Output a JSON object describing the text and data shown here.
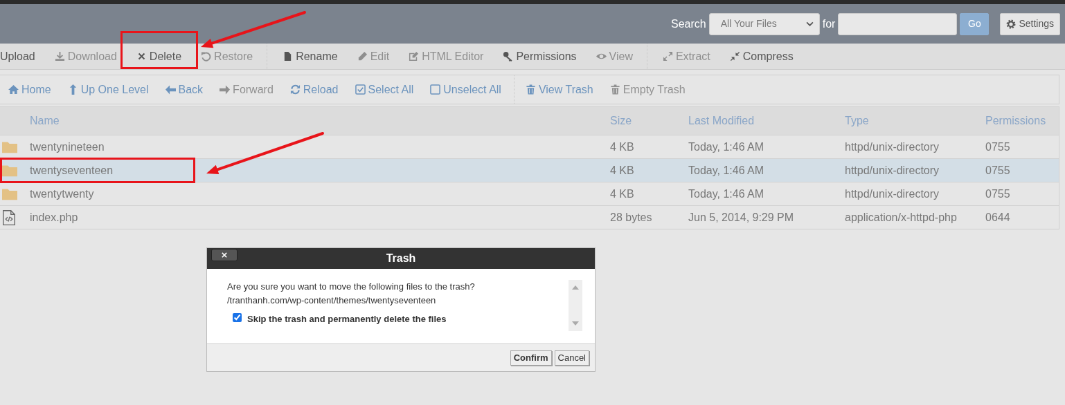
{
  "header": {
    "search_label": "Search",
    "scope": {
      "value": "All Your Files"
    },
    "for_label": "for",
    "go_button": "Go",
    "settings_button": "Settings"
  },
  "file_toolbar": {
    "groups": [
      {
        "tools": [
          {
            "label": "Upload",
            "disabled": false,
            "highlighted": false
          },
          {
            "label": "Download",
            "disabled": true,
            "highlighted": false
          },
          {
            "label": "Delete",
            "disabled": false,
            "highlighted": true
          },
          {
            "label": "Restore",
            "disabled": true,
            "highlighted": false
          }
        ]
      },
      {
        "tools": [
          {
            "label": "Rename",
            "disabled": false,
            "highlighted": false
          },
          {
            "label": "Edit",
            "disabled": true,
            "highlighted": false
          },
          {
            "label": "HTML Editor",
            "disabled": true,
            "highlighted": false
          },
          {
            "label": "Permissions",
            "disabled": false,
            "highlighted": false
          },
          {
            "label": "View",
            "disabled": true,
            "highlighted": false
          }
        ]
      },
      {
        "tools": [
          {
            "label": "Extract",
            "disabled": true,
            "highlighted": false
          },
          {
            "label": "Compress",
            "disabled": false,
            "highlighted": false
          }
        ]
      }
    ]
  },
  "nav_toolbar": {
    "groups": [
      {
        "tools": [
          {
            "label": "Home",
            "disabled": false
          },
          {
            "label": "Up One Level",
            "disabled": false
          },
          {
            "label": "Back",
            "disabled": false
          },
          {
            "label": "Forward",
            "disabled": true
          },
          {
            "label": "Reload",
            "disabled": false
          },
          {
            "label": "Select All",
            "disabled": false
          },
          {
            "label": "Unselect All",
            "disabled": false
          }
        ]
      },
      {
        "tools": [
          {
            "label": "View Trash",
            "disabled": false
          },
          {
            "label": "Empty Trash",
            "disabled": true
          }
        ]
      }
    ]
  },
  "table": {
    "columns": [
      "Name",
      "Size",
      "Last Modified",
      "Type",
      "Permissions"
    ],
    "rows": [
      {
        "kind": "folder",
        "name": "twentynineteen",
        "size": "4 KB",
        "modified": "Today, 1:46 AM",
        "type": "httpd/unix-directory",
        "permissions": "0755",
        "selected": false,
        "highlighted": false
      },
      {
        "kind": "folder",
        "name": "twentyseventeen",
        "size": "4 KB",
        "modified": "Today, 1:46 AM",
        "type": "httpd/unix-directory",
        "permissions": "0755",
        "selected": true,
        "highlighted": true
      },
      {
        "kind": "folder",
        "name": "twentytwenty",
        "size": "4 KB",
        "modified": "Today, 1:46 AM",
        "type": "httpd/unix-directory",
        "permissions": "0755",
        "selected": false,
        "highlighted": false
      },
      {
        "kind": "file",
        "name": "index.php",
        "size": "28 bytes",
        "modified": "Jun 5, 2014, 9:29 PM",
        "type": "application/x-httpd-php",
        "permissions": "0644",
        "selected": false,
        "highlighted": false
      }
    ]
  },
  "dialog": {
    "title": "Trash",
    "message": "Are you sure you want to move the following files to the trash?",
    "path": "/tranthanh.com/wp-content/themes/twentyseventeen",
    "skip_trash": {
      "label": "Skip the trash and permanently delete the files",
      "checked": true
    },
    "buttons": [
      {
        "label": "Confirm",
        "kind": "primary"
      },
      {
        "label": "Cancel",
        "kind": "secondary"
      }
    ]
  }
}
